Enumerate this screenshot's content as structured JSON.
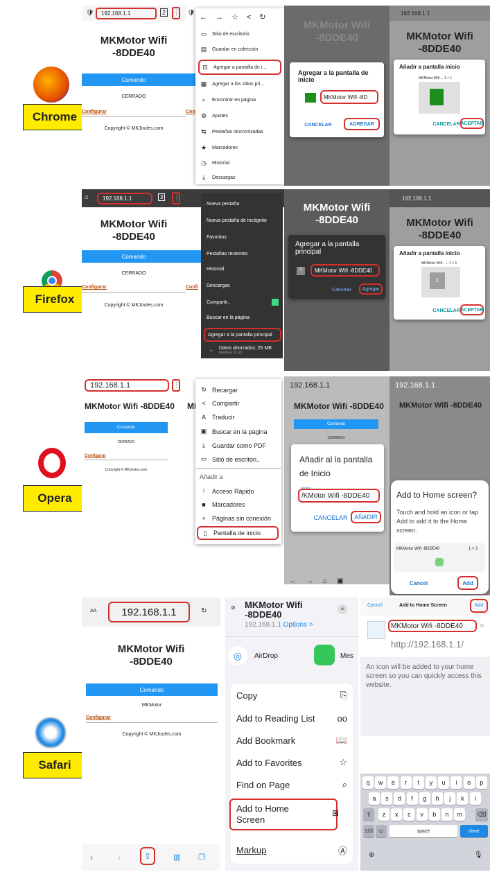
{
  "labels": {
    "chrome": "Chrome",
    "firefox": "Firefox",
    "opera": "Opera",
    "safari": "Safari"
  },
  "common": {
    "ip": "192.168.1.1",
    "title1": "MKMotor Wifi",
    "title2": "-8DDE40",
    "title_one": "MKMotor Wifi -8DDE40",
    "comando": "Comando",
    "cerrado": "CERRADO",
    "configurar": "Configurar",
    "copyright": "Copyright © MKJoules.com",
    "conf_trunc": "Confi",
    "mk_trunc": "MK"
  },
  "row1": {
    "menu": [
      "Sitio de escritorio",
      "Guardar en colección",
      "Agregar a pantalla de i...",
      "Agregar a los sitios pri...",
      "Encontrar en página",
      "Ajustes",
      "Pestañas sincronizadas",
      "Marcadores",
      "Historial",
      "Descargas"
    ],
    "dlg1": {
      "title": "Agregar a la pantalla de inicio",
      "value": "MKMotor Wifi -8D",
      "cancel": "CANCELAR",
      "add": "AGREGAR"
    },
    "dlg2": {
      "title": "Añadir a pantalla inicio",
      "sub": "MKMotor Wifi ... 1 × 1",
      "cancel": "CANCELAR",
      "accept": "ACEPTAR"
    }
  },
  "row2": {
    "menu": [
      "Nueva pestaña",
      "Nueva pestaña de incógnito",
      "Favoritos",
      "Pestañas recientes",
      "Historial",
      "Descargas",
      "Compartir..",
      "Buscar en la página",
      "Agregar a la pantalla principal"
    ],
    "saved": "Datos ahorrados: 25 MB",
    "saved_sub": "desde el 21 oct",
    "dlg1": {
      "title": "Agregar a la pantalla principal",
      "value": "MKMotor Wifi -8DDE40",
      "cancel": "Cancelar",
      "add": "Agregar"
    },
    "dlg2": {
      "title": "Añadir a pantalla inicio",
      "sub": "MKMotor Wifi - ... 1 × 1",
      "cancel": "CANCELAR",
      "accept": "ACEPTAR"
    }
  },
  "row3": {
    "menu": [
      "Recargar",
      "Compartir",
      "Traducir",
      "Buscar en la página",
      "Guardar como PDF",
      "Sitio de escritori.."
    ],
    "menu_head": "Añadir a",
    "menu2": [
      "Acceso Rápido",
      "Marcadores",
      "Páginas sin conexión",
      "Pantalla de inicio"
    ],
    "dlg1": {
      "title": "Añadir al la pantalla de Inicio",
      "field_label": "Nombre",
      "value": "/KMotor Wifi -8DDE40",
      "cancel": "CANCELAR",
      "add": "AÑADIR"
    },
    "dlg2": {
      "title": "Add to Home screen?",
      "body": "Touch and hold an icon or tap Add to add it to the Home screen.",
      "item": "MKMotor Wifi -8DDE40",
      "size": "1 × 1",
      "cancel": "Cancel",
      "add": "Add"
    }
  },
  "row4": {
    "aa": "AA",
    "mkmotor": "MKMotor",
    "share": {
      "title1": "MKMotor Wifi",
      "title2": "-8DDE40",
      "url": "192.168.1.1",
      "options": "Options >",
      "airdrop": "AirDrop",
      "mes": "Mes",
      "items": [
        "Copy",
        "Add to Reading List",
        "Add Bookmark",
        "Add to Favorites",
        "Find on Page",
        "Add to Home Screen",
        "Markup"
      ]
    },
    "home": {
      "cancel": "Cancel",
      "title": "Add to Home Screen",
      "add": "Add",
      "name": "MKMotor Wifi -8DDE40",
      "url": "http://192.168.1.1/",
      "info": "An icon will be added to your home screen so you can quickly access this website."
    },
    "kb": {
      "r1": [
        "q",
        "w",
        "e",
        "r",
        "t",
        "y",
        "u",
        "i",
        "o",
        "p"
      ],
      "r2": [
        "a",
        "s",
        "d",
        "f",
        "g",
        "h",
        "j",
        "k",
        "l"
      ],
      "r3": [
        "z",
        "x",
        "c",
        "v",
        "b",
        "n",
        "m"
      ],
      "n123": "123",
      "space": "space",
      "done": "done"
    }
  },
  "colors": {
    "accent": "#2196f3",
    "highlight": "#d32f2f",
    "label": "#ffeb00",
    "link": "#b84a00"
  },
  "icons": [
    "firefox-logo",
    "chrome-logo",
    "opera-logo",
    "safari-logo",
    "menu-dots-icon",
    "share-icon"
  ]
}
